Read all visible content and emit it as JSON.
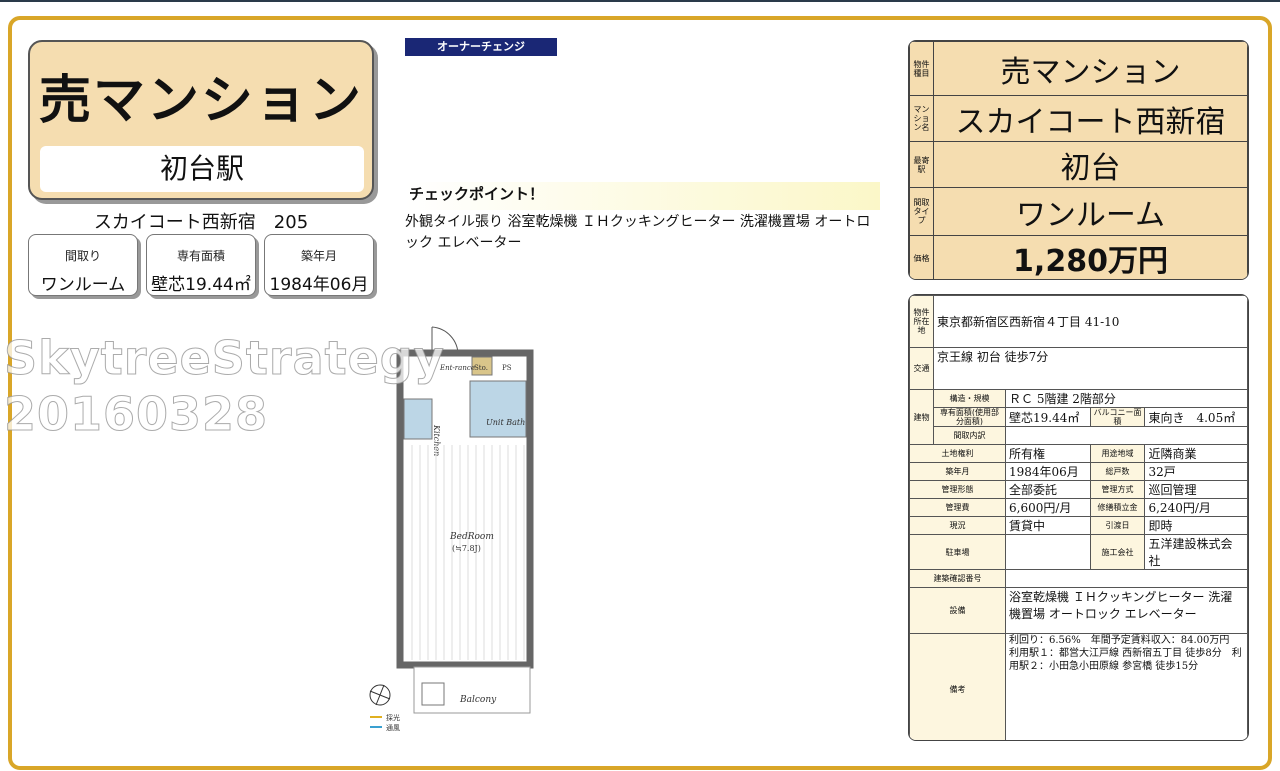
{
  "hero": {
    "type": "売マンション",
    "station": "初台駅"
  },
  "building_line": "スカイコート西新宿　205",
  "mini": [
    {
      "title": "間取り",
      "value": "ワンルーム"
    },
    {
      "title": "専有面積",
      "value": "壁芯19.44㎡"
    },
    {
      "title": "築年月",
      "value": "1984年06月"
    }
  ],
  "owner_badge": "オーナーチェンジ",
  "check": {
    "title": "チェックポイント！",
    "body": "外観タイル張り 浴室乾燥機 ＩＨクッキングヒーター 洗濯機置場 オートロック エレベーター"
  },
  "watermark": [
    "SkytreeStrategy",
    "20160328"
  ],
  "plan": {
    "entrance": "Ent-rance",
    "sto": "Sto.",
    "ps": "PS",
    "kitchen": "Kitchen",
    "bath": "Unit Bath",
    "bedroom": "BedRoom",
    "bedroom_size": "(≒7.8J)",
    "balcony": "Balcony",
    "legend1": "採光",
    "legend2": "通風"
  },
  "summary": {
    "type_label": "物件種目",
    "type": "売マンション",
    "name_label": "マンション名",
    "name": "スカイコート西新宿",
    "station_label": "最寄駅",
    "station": "初台",
    "layout_label": "間取タイプ",
    "layout": "ワンルーム",
    "price_label": "価格",
    "price": "1,280万円"
  },
  "details": {
    "addr_label": "物件所在地",
    "addr": "東京都新宿区西新宿４丁目 41-10",
    "access_label": "交通",
    "access": "京王線 初台 徒歩7分",
    "bldg_label": "建物",
    "struct_label": "構造・規模",
    "struct": "ＲＣ 5階建 2階部分",
    "area_label": "専有面積(使用部分面積)",
    "area": "壁芯19.44㎡",
    "balc_label": "バルコニー面積",
    "balc": "東向き　4.05㎡",
    "inner_label": "間取内訳",
    "inner": "",
    "land_label": "土地権利",
    "land": "所有権",
    "zone_label": "用途地域",
    "zone": "近隣商業",
    "built_label": "築年月",
    "built": "1984年06月",
    "units_label": "総戸数",
    "units": "32戸",
    "mgmt_label": "管理形態",
    "mgmt": "全部委託",
    "mgmt_type_label": "管理方式",
    "mgmt_type": "巡回管理",
    "fee_label": "管理費",
    "fee": "6,600円/月",
    "repair_label": "修繕積立金",
    "repair": "6,240円/月",
    "status_label": "現況",
    "status": "賃貸中",
    "handover_label": "引渡日",
    "handover": "即時",
    "parking_label": "駐車場",
    "parking": "",
    "builder_label": "施工会社",
    "builder": "五洋建設株式会社",
    "confirm_label": "建築確認番号",
    "confirm": "",
    "equip_label": "設備",
    "equip": "浴室乾燥機 ＩＨクッキングヒーター 洗濯機置場 オートロック エレベーター",
    "note_label": "備考",
    "note": "利回り：6.56%　年間予定賃料収入：84.00万円　利用駅１：都営大江戸線 西新宿五丁目 徒歩8分　利用駅２：小田急小田原線 参宮橋 徒歩15分"
  }
}
